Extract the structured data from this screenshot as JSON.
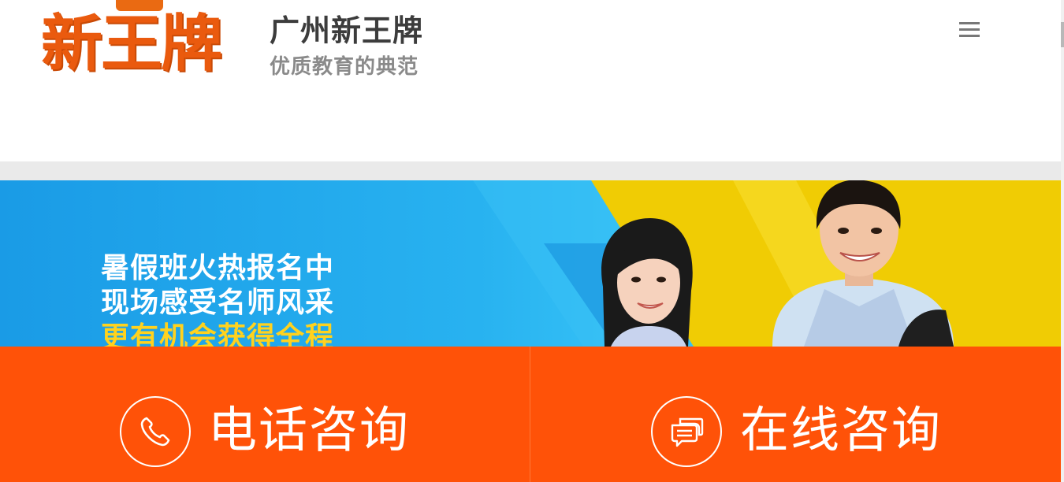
{
  "header": {
    "logo_mark": "新王牌",
    "logo_name": "广州新王牌",
    "logo_slogan": "优质教育的典范",
    "menu_icon": "hamburger-menu-icon"
  },
  "banner": {
    "lines": [
      "暑假班火热报名中",
      "现场感受名师风采",
      "更有机会获得全程"
    ],
    "highlight_color": "#ffd21e",
    "bg_color": "#28b2f0",
    "accent_color": "#f2cf04"
  },
  "cta": {
    "bg_color": "#ff5208",
    "items": [
      {
        "label": "电话咨询",
        "icon": "phone-icon"
      },
      {
        "label": "在线咨询",
        "icon": "chat-bubbles-icon"
      }
    ]
  }
}
